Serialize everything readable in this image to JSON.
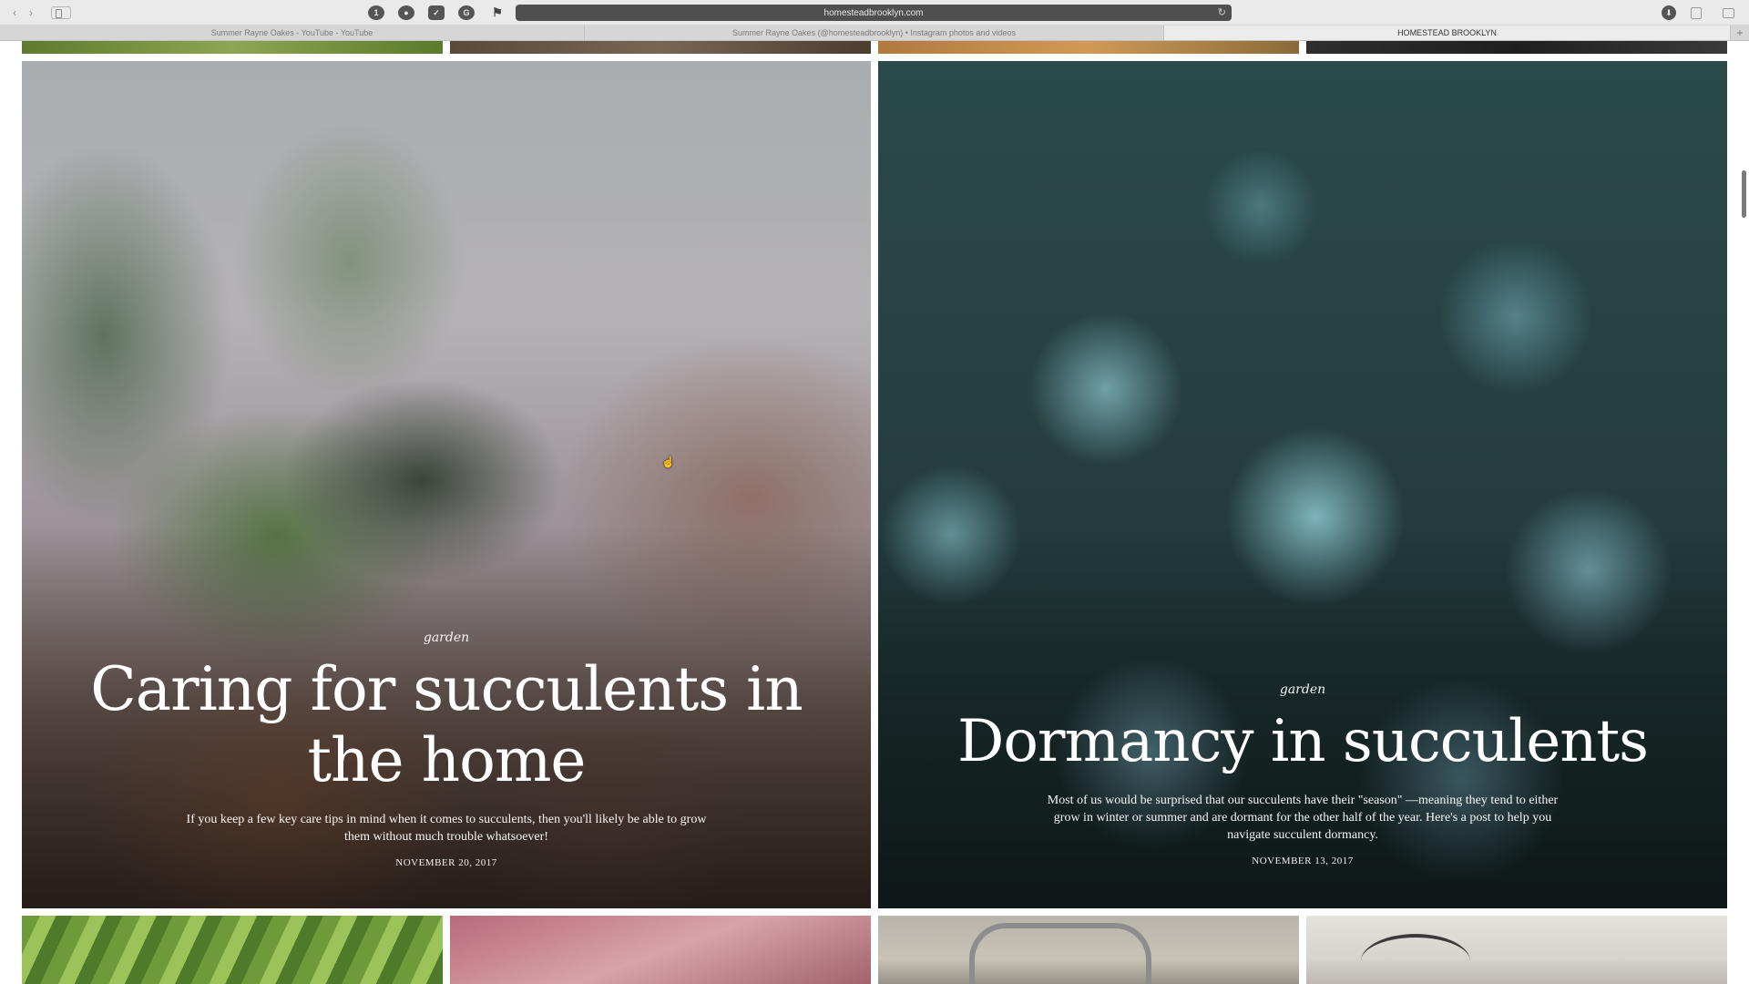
{
  "browser": {
    "url": "homesteadbrooklyn.com",
    "tabs": [
      {
        "label": "Summer Rayne Oakes - YouTube - YouTube"
      },
      {
        "label": "Summer Rayne Oakes (@homesteadbrooklyn) • Instagram photos and videos"
      },
      {
        "label": "HOMESTEAD BROOKLYN"
      }
    ],
    "new_tab_label": "+",
    "icons": {
      "back": "chevron-left-icon",
      "forward": "chevron-right-icon",
      "sidebar": "sidebar-icon",
      "reload": "reload-icon",
      "download": "download-icon",
      "share": "share-icon",
      "tabs": "tabs-icon"
    },
    "glyphs": {
      "back": "‹",
      "forward": "›",
      "reload": "↻",
      "ext1": "1",
      "ext2": "●",
      "ext3": "✓",
      "ext4": "G",
      "ext5": "⚑",
      "download": "⬇"
    }
  },
  "posts": [
    {
      "category": "garden",
      "title": "Caring for succulents in the home",
      "excerpt": "If you keep a few key care tips in mind when it comes to succulents, then you'll likely be able to grow them without much trouble whatsoever!",
      "date": "NOVEMBER 20, 2017"
    },
    {
      "category": "garden",
      "title": "Dormancy in succulents",
      "excerpt": "Most of us would be surprised that our succulents have their \"season\" —meaning they tend to either grow in winter or summer and are dormant for the other half of the year. Here's a post to help you navigate succulent dormancy.",
      "date": "NOVEMBER 13, 2017"
    }
  ],
  "cursor_glyph": "☝"
}
